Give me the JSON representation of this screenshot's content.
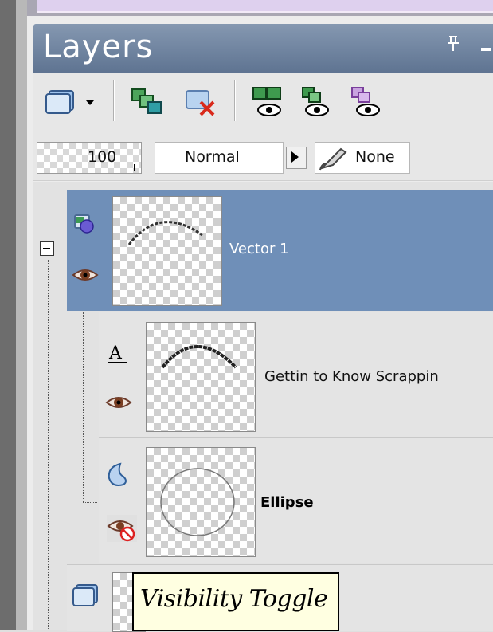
{
  "panel": {
    "title": "Layers",
    "pin_glyph": "⅄"
  },
  "toolbar": {
    "icons": [
      "new-layer-dropdown-icon",
      "duplicate-layer-icon",
      "delete-layer-icon",
      "show-all-layers-icon",
      "invert-visibility-icon",
      "hide-all-layers-icon"
    ]
  },
  "properties": {
    "opacity": "100",
    "blend_mode": "Normal",
    "mask": "None"
  },
  "layers": [
    {
      "name": "Vector 1",
      "type_icon": "vector-layer-icon",
      "visibility_icon": "eye-icon",
      "selected": true
    },
    {
      "name": "Gettin to Know Scrappin",
      "type_icon": "text-object-icon",
      "visibility_icon": "eye-icon",
      "selected": false
    },
    {
      "name": "Ellipse",
      "type_icon": "shape-object-icon",
      "visibility_icon": "eye-hidden-icon",
      "selected": false
    },
    {
      "name": "",
      "type_icon": "raster-layer-icon",
      "visibility_icon": "",
      "selected": false
    }
  ],
  "tooltip": {
    "text": "Visibility Toggle"
  },
  "colors": {
    "selected_row": "#6f8fb8",
    "titlebar": "#6f82a0",
    "tooltip_bg": "#ffffe1"
  }
}
